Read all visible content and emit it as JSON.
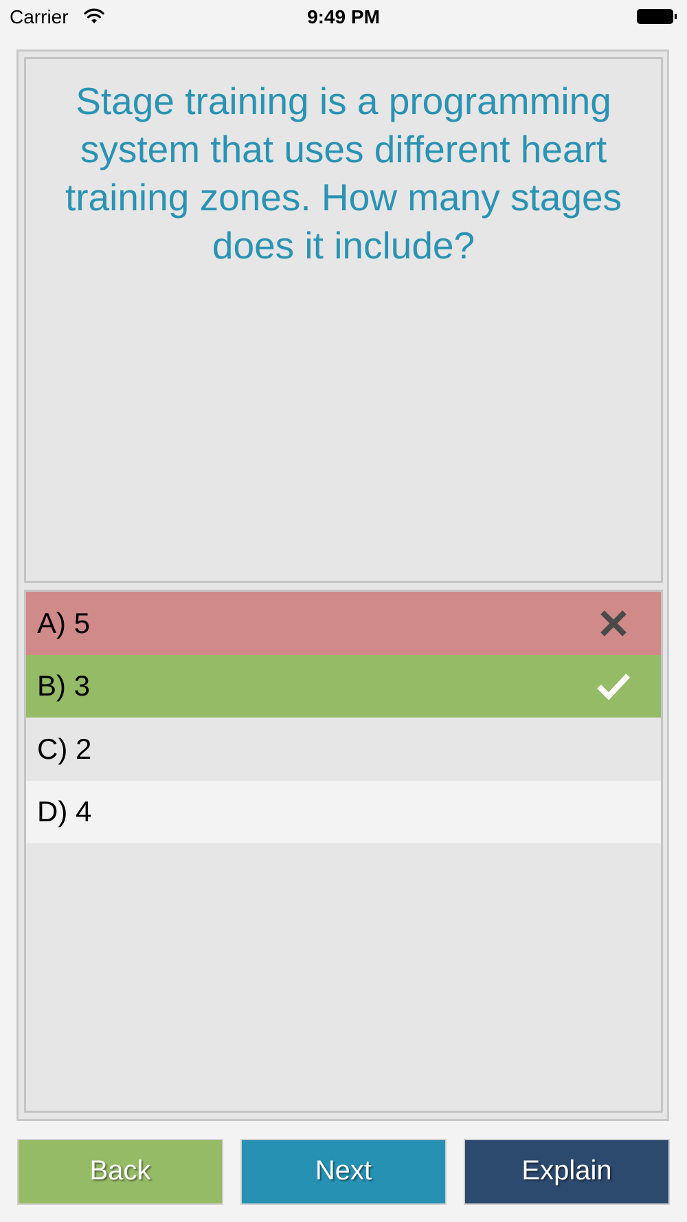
{
  "status_bar": {
    "carrier": "Carrier",
    "time": "9:49 PM",
    "wifi_icon": "wifi-icon",
    "battery_icon": "battery-icon"
  },
  "question": {
    "text": "Stage training is a programming system that uses different heart training zones. How many stages does it include?",
    "color": "#2a93b3"
  },
  "answers": [
    {
      "label": "A) 5",
      "state": "incorrect",
      "color": "#cf8a89",
      "icon": "cross-icon"
    },
    {
      "label": "B) 3",
      "state": "correct",
      "color": "#95bb66",
      "icon": "check-icon"
    },
    {
      "label": "C) 2",
      "state": "neutral",
      "color": "#e6e6e6"
    },
    {
      "label": "D) 4",
      "state": "neutral",
      "color": "#f3f3f3"
    }
  ],
  "buttons": {
    "back": {
      "label": "Back",
      "color": "#95bb66"
    },
    "next": {
      "label": "Next",
      "color": "#2691b2"
    },
    "explain": {
      "label": "Explain",
      "color": "#2b4a6e"
    }
  }
}
